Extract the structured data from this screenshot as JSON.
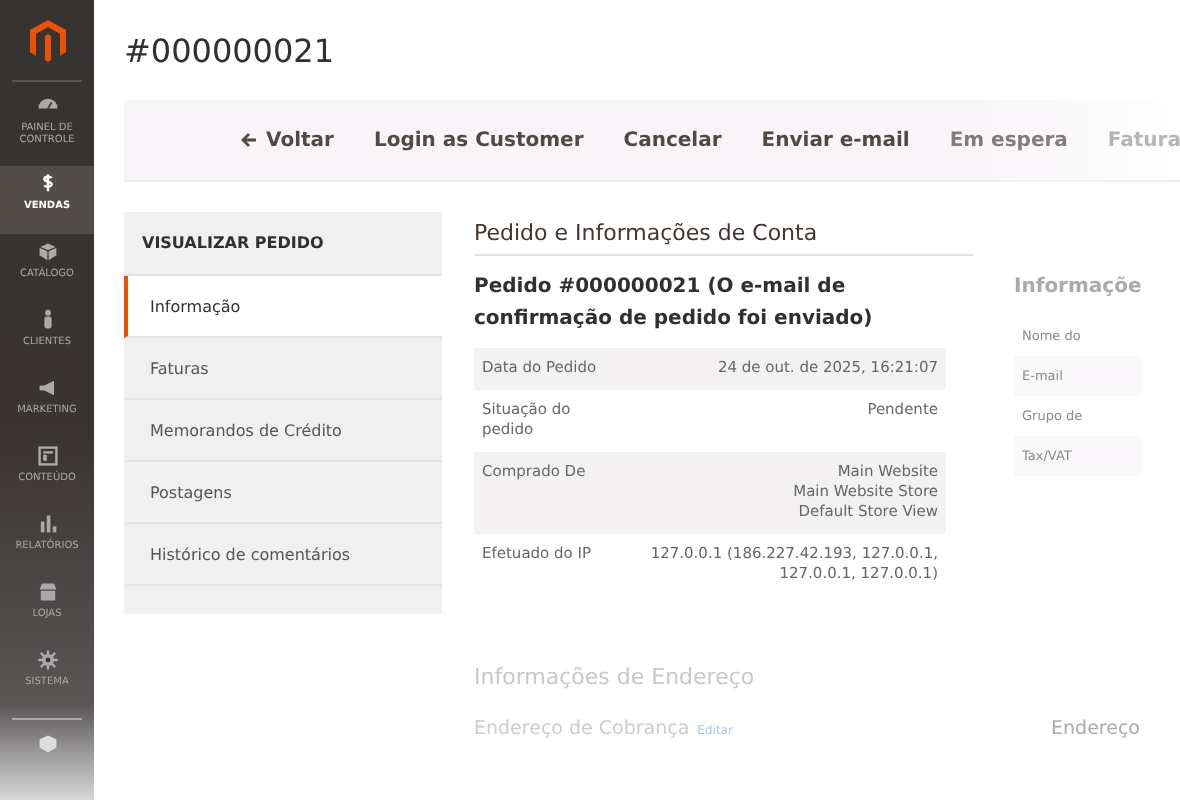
{
  "sidebar": {
    "items": [
      {
        "label": "PAINEL DE CONTROLE",
        "selected": false
      },
      {
        "label": "VENDAS",
        "selected": true
      },
      {
        "label": "CATÁLOGO",
        "selected": false
      },
      {
        "label": "CLIENTES",
        "selected": false
      },
      {
        "label": "MARKETING",
        "selected": false
      },
      {
        "label": "CONTEÚDO",
        "selected": false
      },
      {
        "label": "RELATÓRIOS",
        "selected": false
      },
      {
        "label": "LOJAS",
        "selected": false
      },
      {
        "label": "SISTEMA",
        "selected": false
      }
    ]
  },
  "page_title": "#000000021",
  "toolbar": [
    "Voltar",
    "Login as Customer",
    "Cancelar",
    "Enviar e-mail",
    "Em espera",
    "Fatura"
  ],
  "order_nav": {
    "title": "VISUALIZAR PEDIDO",
    "tabs": [
      {
        "label": "Informação",
        "selected": true
      },
      {
        "label": "Faturas",
        "selected": false
      },
      {
        "label": "Memorandos de Crédito",
        "selected": false
      },
      {
        "label": "Postagens",
        "selected": false
      },
      {
        "label": "Histórico de comentários",
        "selected": false
      }
    ]
  },
  "section_title": "Pedido e Informações de Conta",
  "order": {
    "title": "Pedido #000000021 (O e-mail de confirmação de pedido foi enviado)",
    "rows": [
      {
        "label": "Data do Pedido",
        "value": [
          "24 de out. de 2025, 16:21:07"
        ]
      },
      {
        "label": "Situação do pedido",
        "value": [
          "Pendente"
        ]
      },
      {
        "label": "Comprado De",
        "value": [
          "Main Website",
          "Main Website Store",
          "Default Store View"
        ]
      },
      {
        "label": "Efetuado do IP",
        "value": [
          "127.0.0.1 (186.227.42.193, 127.0.0.1, 127.0.0.1, 127.0.0.1)"
        ]
      }
    ]
  },
  "account": {
    "title": "Informaçõe",
    "rows": [
      "Nome do",
      "E-mail",
      "Grupo de",
      "Tax/VAT"
    ]
  },
  "address": {
    "title": "Informações de Endereço",
    "billing_title": "Endereço de Cobrança",
    "edit_link": "Editar",
    "shipping_title": "Endereço"
  }
}
